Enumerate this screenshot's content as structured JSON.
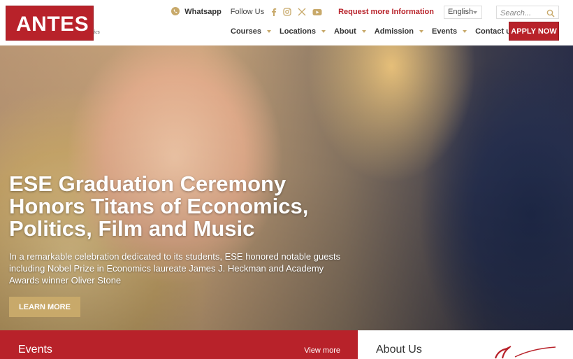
{
  "brand": {
    "logo_text": "ANTES",
    "logo_tail": "ics"
  },
  "topbar": {
    "whatsapp_label": "Whatsapp",
    "follow_label": "Follow Us",
    "request_label": "Request more Information",
    "language": "English",
    "search_placeholder": "Search..."
  },
  "nav": {
    "items": [
      {
        "label": "Courses"
      },
      {
        "label": "Locations"
      },
      {
        "label": "About"
      },
      {
        "label": "Admission"
      },
      {
        "label": "Events"
      },
      {
        "label": "Contact us"
      }
    ],
    "apply_label": "APPLY NOW"
  },
  "hero": {
    "title_lines": [
      "ESE Graduation Ceremony",
      "Honors Titans of Economics,",
      "Politics, Film and Music"
    ],
    "description": "In a remarkable celebration dedicated to its students, ESE honored notable guests including Nobel Prize in Economics laureate James J. Heckman and Academy Awards winner Oliver Stone",
    "cta_label": "LEARN MORE"
  },
  "events": {
    "title": "Events",
    "view_more": "View more"
  },
  "about": {
    "title": "About Us"
  },
  "icons": [
    "whatsapp-icon",
    "facebook-icon",
    "instagram-icon",
    "x-icon",
    "youtube-icon",
    "search-icon"
  ],
  "colors": {
    "brand_red": "#b8222a",
    "accent_gold": "#c8a96a"
  }
}
